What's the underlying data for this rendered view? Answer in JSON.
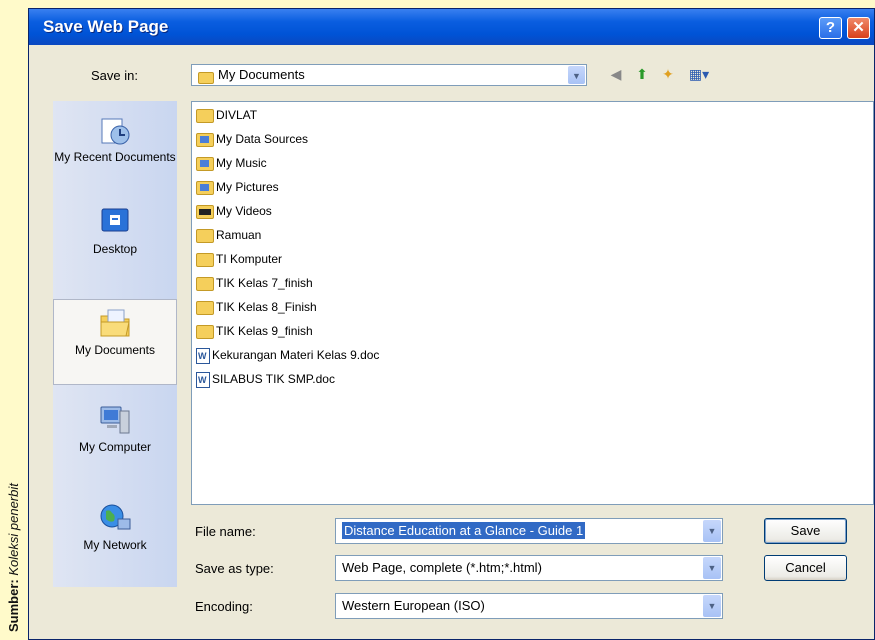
{
  "credit": {
    "label": "Sumber:",
    "source": "Koleksi penerbit"
  },
  "window": {
    "title": "Save Web Page",
    "help_glyph": "?",
    "close_glyph": "✕"
  },
  "save_in": {
    "label": "Save in:",
    "value": "My Documents"
  },
  "places": [
    {
      "label": "My Recent Documents",
      "icon": "recent-documents-icon"
    },
    {
      "label": "Desktop",
      "icon": "desktop-icon"
    },
    {
      "label": "My Documents",
      "icon": "my-documents-icon",
      "selected": true
    },
    {
      "label": "My Computer",
      "icon": "computer-icon"
    },
    {
      "label": "My Network",
      "icon": "network-icon"
    }
  ],
  "files": [
    {
      "name": "DIVLAT",
      "type": "folder"
    },
    {
      "name": "My Data Sources",
      "type": "special"
    },
    {
      "name": "My Music",
      "type": "special"
    },
    {
      "name": "My Pictures",
      "type": "special"
    },
    {
      "name": "My Videos",
      "type": "video"
    },
    {
      "name": "Ramuan",
      "type": "folder"
    },
    {
      "name": "TI Komputer",
      "type": "folder"
    },
    {
      "name": "TIK Kelas 7_finish",
      "type": "folder"
    },
    {
      "name": "TIK Kelas 8_Finish",
      "type": "folder"
    },
    {
      "name": "TIK Kelas 9_finish",
      "type": "folder"
    },
    {
      "name": "Kekurangan Materi Kelas 9.doc",
      "type": "doc"
    },
    {
      "name": "SILABUS TIK SMP.doc",
      "type": "doc"
    }
  ],
  "form": {
    "file_name_label": "File name:",
    "file_name_value": "Distance Education at a Glance - Guide 1",
    "save_as_type_label": "Save as type:",
    "save_as_type_value": "Web Page, complete (*.htm;*.html)",
    "encoding_label": "Encoding:",
    "encoding_value": "Western European (ISO)"
  },
  "buttons": {
    "save": "Save",
    "cancel": "Cancel"
  },
  "colors": {
    "titlebar": "#0053d6",
    "dialog_bg": "#ece9d8",
    "selection": "#316ac5",
    "page_bg": "#fffaca"
  }
}
